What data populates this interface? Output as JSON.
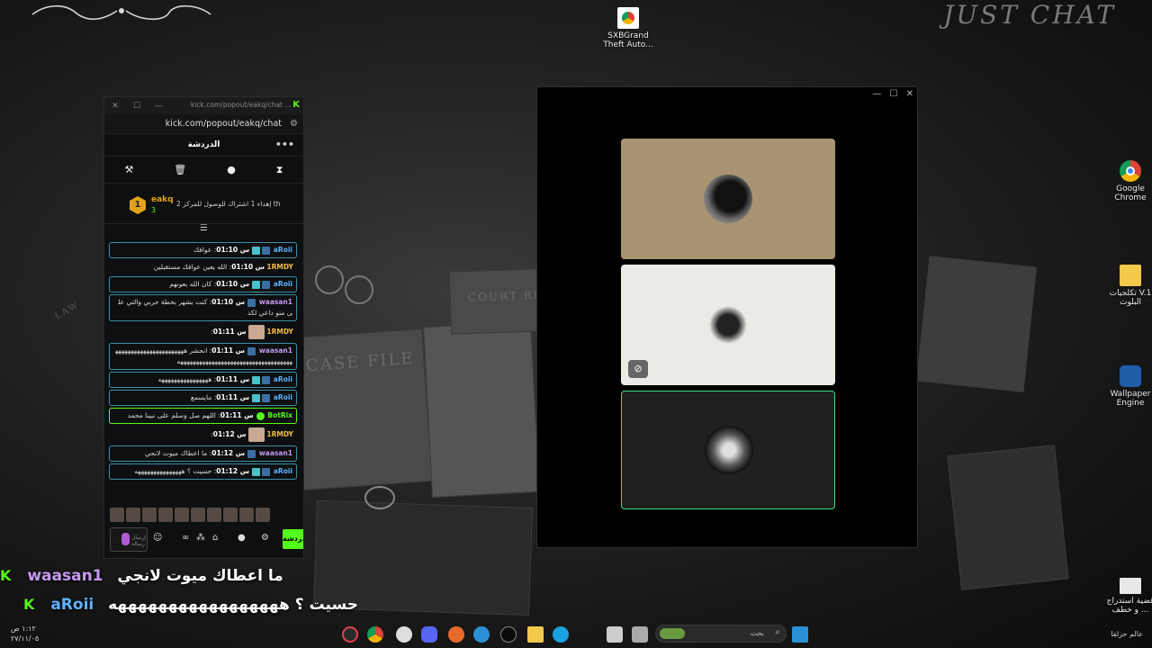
{
  "desktop": {
    "brand_text": "JUST CHAT",
    "icons": [
      {
        "label": "SXBGrand Theft Auto...",
        "icon": "chrome-shortcut-icon"
      },
      {
        "label": "Google Chrome",
        "icon": "chrome-icon"
      },
      {
        "label": "تكلجيات V.1 البلوت",
        "icon": "folder-icon"
      },
      {
        "label": "Wallpaper Engine",
        "icon": "wallpaper-engine-icon"
      },
      {
        "label": "قضية استدراج ... و خطف",
        "icon": "document-icon"
      }
    ],
    "bg_texts": [
      "CASE FILE",
      "COURT REC",
      "LAW"
    ]
  },
  "chat_window": {
    "tab_title": "kick.com/popout/eakq/chat ...",
    "url": "kick.com/popout/eakq/chat",
    "header_title": "الدردشة",
    "pinned": {
      "rank": "1",
      "username": "eakq",
      "count": "3",
      "text": "إهداء 1 اشتراك للوصول للمركز 2 th"
    },
    "messages": [
      {
        "time": "01:10 س",
        "user": "aRoii",
        "user_color": "#5fb2ff",
        "text": "عوافك",
        "style": "bordered",
        "badges": [
          "t",
          "b"
        ]
      },
      {
        "time": "01:10 س",
        "user": "1RMDY",
        "user_color": "#f0c040",
        "text": "الله يعين عوافك مستقبلين",
        "style": "plain",
        "badges": []
      },
      {
        "time": "01:10 س",
        "user": "aRoii",
        "user_color": "#5fb2ff",
        "text": "كان الله بعونهم",
        "style": "bordered",
        "badges": [
          "t",
          "b"
        ]
      },
      {
        "time": "01:10 س",
        "user": "waasan1",
        "user_color": "#c59af0",
        "text": "كنت بشهر بخطة حربي والتي على متو داعي لكذ",
        "style": "bordered",
        "badges": [
          "b"
        ]
      },
      {
        "time": "01:11 س",
        "user": "1RMDY",
        "user_color": "#f0c040",
        "text": "",
        "style": "plain",
        "badges": [
          "avatar"
        ]
      },
      {
        "time": "01:11 س",
        "user": "waasan1",
        "user_color": "#c59af0",
        "text": "انحشر هههههههههههههههههههههههههههههههههههههههههههههههههههههههههههه",
        "style": "bordered",
        "badges": [
          "b"
        ]
      },
      {
        "time": "01:11 س",
        "user": "aRoii",
        "user_color": "#5fb2ff",
        "text": "ههههههههههههههههه",
        "style": "bordered",
        "badges": [
          "t",
          "b"
        ]
      },
      {
        "time": "01:11 س",
        "user": "aRoii",
        "user_color": "#5fb2ff",
        "text": "مايسمع",
        "style": "bordered",
        "badges": [
          "t",
          "b"
        ]
      },
      {
        "time": "01:11 س",
        "user": "BotRix",
        "user_color": "#53fc18",
        "text": "اللهم صل وسلم على نبينا محمد",
        "style": "green",
        "badges": [
          "g"
        ]
      },
      {
        "time": "01:12 س",
        "user": "1RMDY",
        "user_color": "#f0c040",
        "text": "",
        "style": "plain",
        "badges": [
          "avatar"
        ]
      },
      {
        "time": "01:12 س",
        "user": "waasan1",
        "user_color": "#c59af0",
        "text": "ما اعطاك ميوت لانجي",
        "style": "bordered",
        "badges": [
          "b"
        ]
      },
      {
        "time": "01:12 س",
        "user": "aRoii",
        "user_color": "#5fb2ff",
        "text": "حسيت ؟ هههههههههههههههه",
        "style": "bordered",
        "badges": [
          "t",
          "b"
        ]
      }
    ],
    "send_label": "دردشة",
    "input_placeholder": "إرسال رسالة"
  },
  "call_window": {
    "controls": "— ☐ ✕"
  },
  "overlay": [
    {
      "user": "waasan1",
      "text": "ما اعطاك ميوت لانجي",
      "user_class": "u1"
    },
    {
      "user": "aRoii",
      "text": "حسيت ؟ هههههههههههههههههه",
      "user_class": "u2"
    }
  ],
  "taskbar": {
    "search_placeholder": "بحث",
    "clock_time": "١:١٢ ص",
    "clock_date": "٢٧/١١/٠٥",
    "bottom_right_text": "عالم حزلقا"
  },
  "colors": {
    "kick_green": "#53fc18",
    "accent_blue": "#3d8fa8",
    "call_bg": "#000000"
  }
}
